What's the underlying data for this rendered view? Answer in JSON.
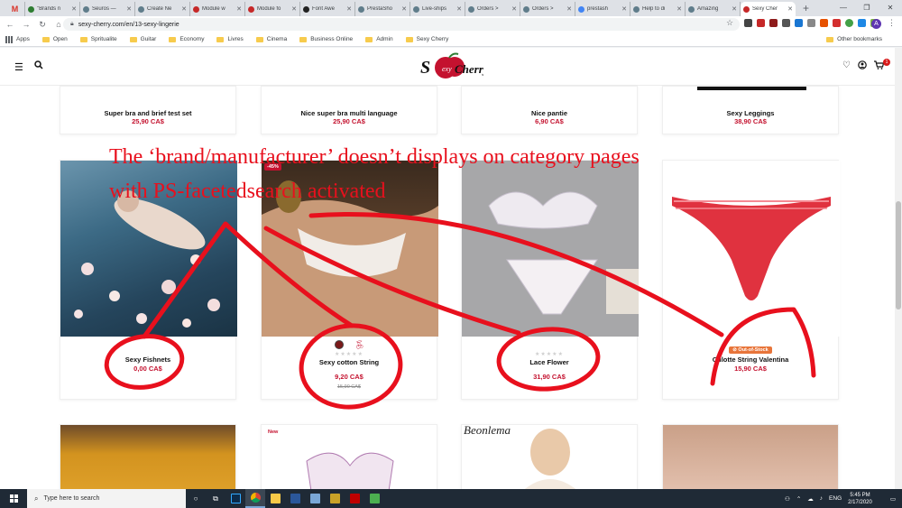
{
  "browser": {
    "tabs": [
      {
        "label": "\"Brands n",
        "color": "#2e7d32"
      },
      {
        "label": "Seuros —",
        "color": "#607d8b"
      },
      {
        "label": "Create Ne",
        "color": "#607d8b"
      },
      {
        "label": "Module w",
        "color": "#c62828"
      },
      {
        "label": "Module fo",
        "color": "#c62828"
      },
      {
        "label": "Font Awe",
        "color": "#222222"
      },
      {
        "label": "PrestaSho",
        "color": "#607d8b"
      },
      {
        "label": "Live-ships",
        "color": "#607d8b"
      },
      {
        "label": "Orders > ",
        "color": "#607d8b"
      },
      {
        "label": "Orders > ",
        "color": "#607d8b"
      },
      {
        "label": "prestash",
        "color": "#4285f4"
      },
      {
        "label": "Help to di",
        "color": "#607d8b"
      },
      {
        "label": "Amazing",
        "color": "#607d8b"
      },
      {
        "label": "Sexy Cher",
        "color": "#c62828"
      }
    ],
    "gmail_label": "M",
    "new_tab": "+",
    "url": "sexy-cherry.com/en/13-sexy-lingerie",
    "profile_initial": "A",
    "bookmarks": [
      "Apps",
      "Open",
      "Spritualite",
      "Guitar",
      "Economy",
      "Livres",
      "Cinema",
      "Business Online",
      "Admin",
      "Sexy Cherry"
    ],
    "other_bookmarks": "Other bookmarks"
  },
  "site": {
    "logo_text": "Sexy Cherry",
    "cart_count": "1",
    "top_row": [
      {
        "name": "Super bra and brief test set",
        "price": "25,90 CA$"
      },
      {
        "name": "Nice super bra multi language",
        "price": "25,90 CA$"
      },
      {
        "name": "Nice pantie",
        "price": "6,90 CA$"
      },
      {
        "name": "Sexy Leggings",
        "price": "38,90 CA$"
      }
    ],
    "products": [
      {
        "name": "Sexy Fishnets",
        "price": "0,00 CA$"
      },
      {
        "name": "Sexy cotton String",
        "price": "9,20 CA$",
        "old_price": "15,90 CA$",
        "discount": "-45%",
        "stars": "★★★★★"
      },
      {
        "name": "Lace Flower",
        "price": "31,90 CA$",
        "stars": "★★★★★"
      },
      {
        "name": "Culotte String Valentina",
        "price": "15,90 CA$",
        "badge": "⊘ Out-of-Stock"
      }
    ],
    "bottom_row": {
      "new_badge": "New",
      "brand_label": "Beonlema"
    }
  },
  "annotation": {
    "line1": "The ‘brand/manufacturer’ doesn’t displays on category pages",
    "line2": "with PS-facetedsearch activated"
  },
  "taskbar": {
    "search_placeholder": "Type here to search",
    "time": "5:45 PM",
    "date": "2/17/2020",
    "lang": "ENG"
  },
  "colors": {
    "accent": "#c4122f",
    "annotation": "#e8101d"
  }
}
